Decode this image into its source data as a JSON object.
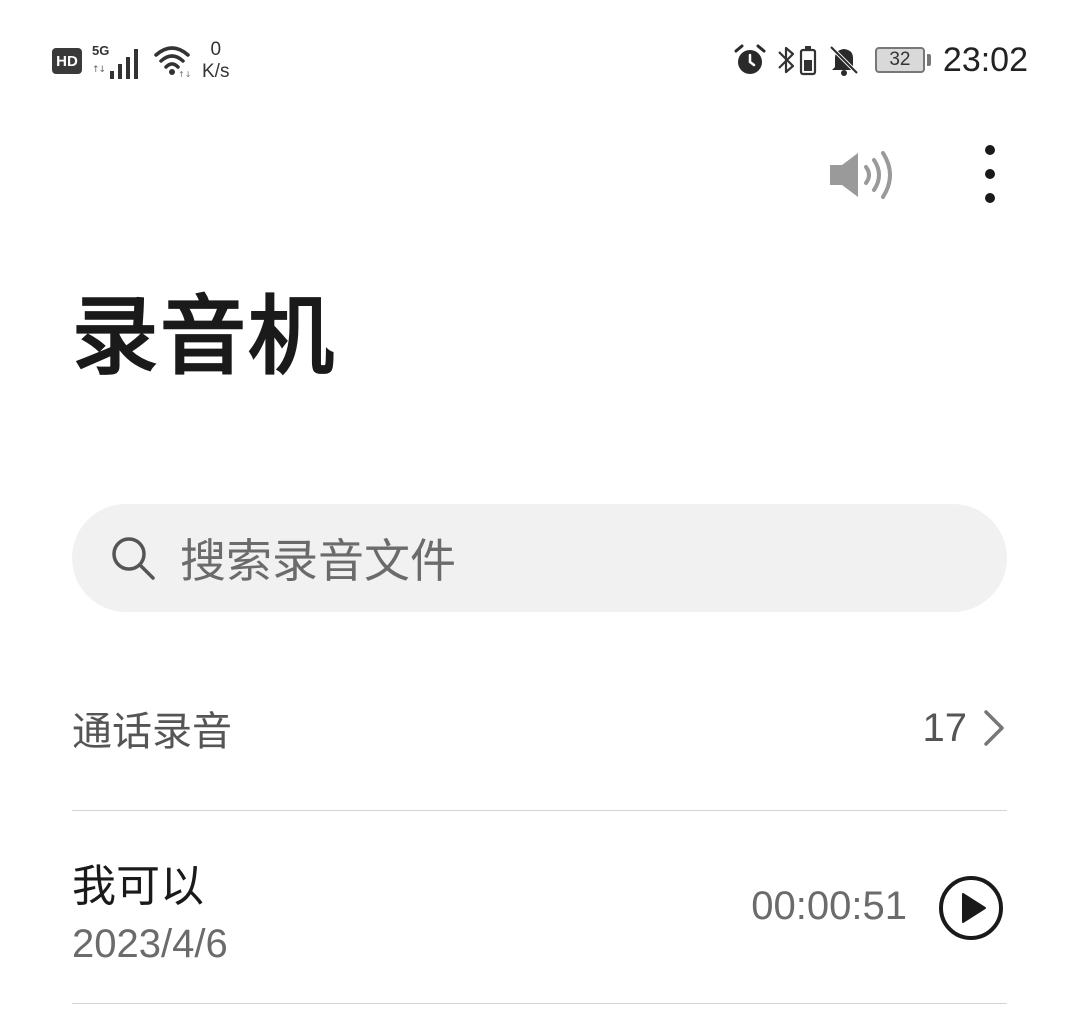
{
  "status_bar": {
    "hd": "HD",
    "network": "5G",
    "speed_value": "0",
    "speed_unit": "K/s",
    "battery": "32",
    "time": "23:02"
  },
  "app": {
    "title": "录音机"
  },
  "search": {
    "placeholder": "搜索录音文件"
  },
  "call_recordings": {
    "label": "通话录音",
    "count": "17"
  },
  "recordings": [
    {
      "name": "我可以",
      "date": "2023/4/6",
      "duration": "00:00:51"
    }
  ],
  "icons": {
    "speaker": "speaker-icon",
    "more": "more-vertical-icon",
    "search": "search-icon",
    "chevron": "chevron-right-icon",
    "play": "play-circle-icon"
  },
  "colors": {
    "search_bg": "#f1f1f1",
    "divider": "#d4d4d4",
    "secondary_text": "#6b6b6b"
  }
}
